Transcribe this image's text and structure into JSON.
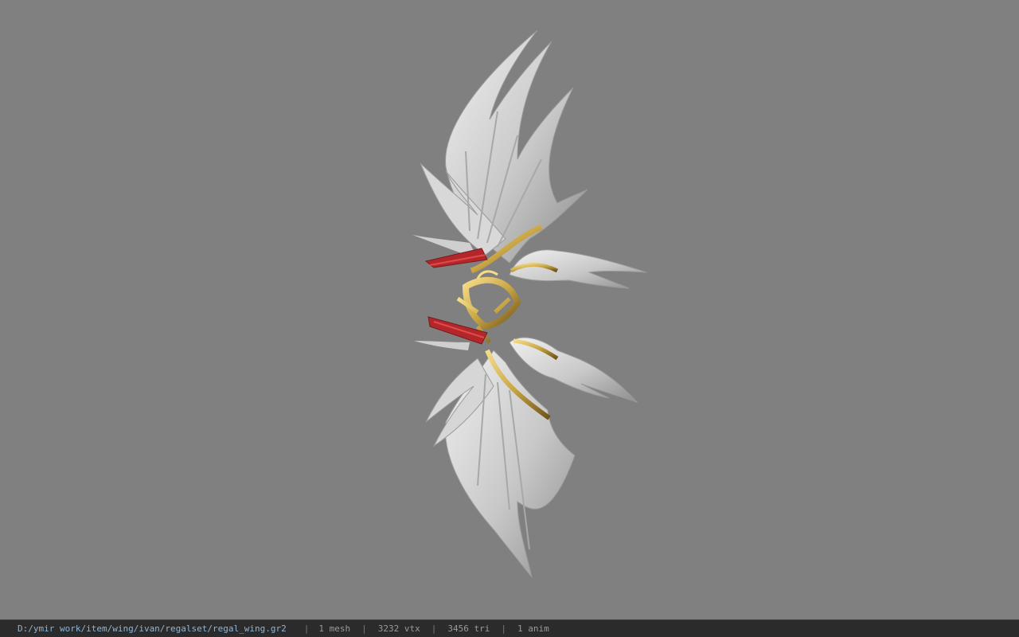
{
  "viewport": {
    "background": "#808080",
    "model": {
      "name": "regal_wing",
      "feather_color": "#d6d6d6",
      "gold_color": "#c9a646",
      "ribbon_color": "#b3272a"
    }
  },
  "statusbar": {
    "file_path": "D:/ymir work/item/wing/ivan/regalset/regal_wing.gr2",
    "separator": "|",
    "mesh_count": "1 mesh",
    "vertex_count": "3232 vtx",
    "triangle_count": "3456 tri",
    "anim_count": "1 anim"
  }
}
